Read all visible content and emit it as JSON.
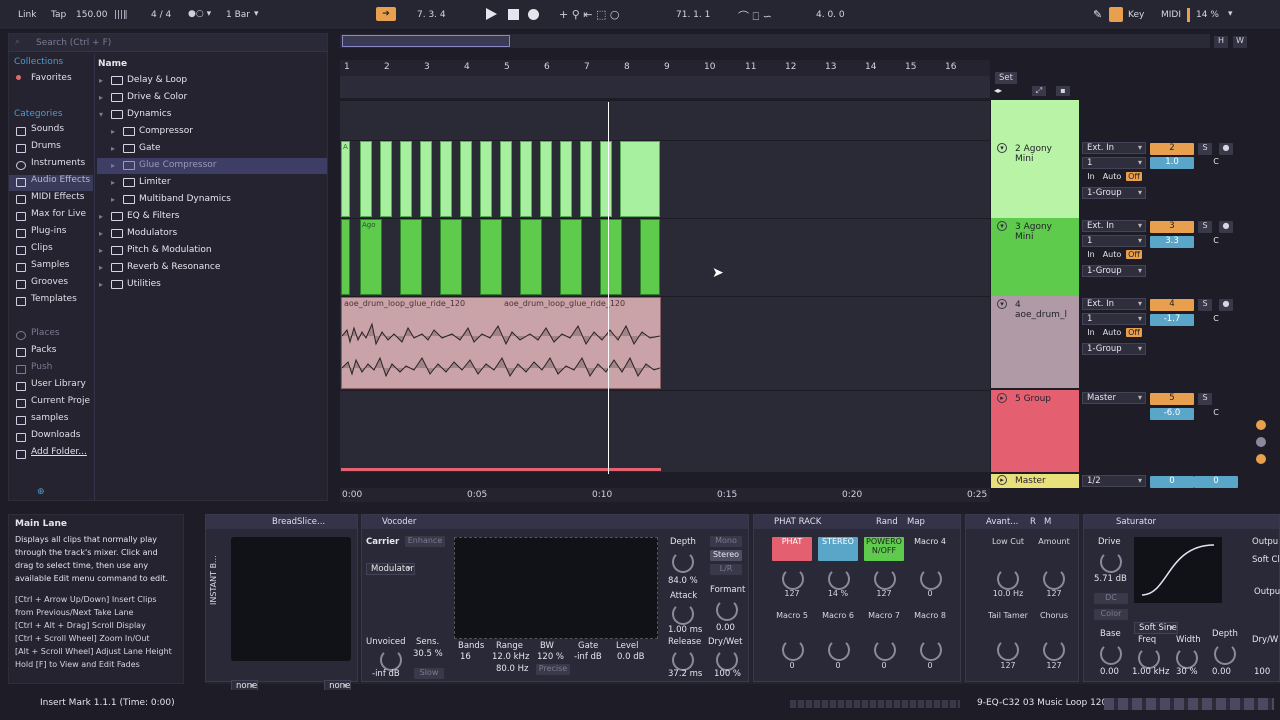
{
  "transport": {
    "link": "Link",
    "tap": "Tap",
    "tempo": "150.00",
    "sig": "4 / 4",
    "quant": "1 Bar",
    "position": "7.  3.  4",
    "loop_start": "71.  1.  1",
    "loop_len": "4.  0.  0",
    "key": "Key",
    "midi": "MIDI",
    "cpu": "14 %"
  },
  "browser": {
    "search_placeholder": "Search (Ctrl + F)",
    "collections_title": "Collections",
    "favorites": "Favorites",
    "categories_title": "Categories",
    "categories": [
      "Sounds",
      "Drums",
      "Instruments",
      "Audio Effects",
      "MIDI Effects",
      "Max for Live",
      "Plug-ins",
      "Clips",
      "Samples",
      "Grooves",
      "Templates"
    ],
    "places_title": "Places",
    "places": [
      "Packs",
      "Push",
      "User Library",
      "Current Proje",
      "samples",
      "Downloads",
      "Add Folder..."
    ],
    "name_header": "Name",
    "items": [
      "Delay & Loop",
      "Drive & Color",
      "Dynamics",
      "Compressor",
      "Gate",
      "Glue Compressor",
      "Limiter",
      "Multiband Dynamics",
      "EQ & Filters",
      "Modulators",
      "Pitch & Modulation",
      "Reverb & Resonance",
      "Utilities"
    ]
  },
  "ruler": {
    "bars": [
      "1",
      "2",
      "3",
      "4",
      "5",
      "6",
      "7",
      "8",
      "9",
      "10",
      "11",
      "12",
      "13",
      "14",
      "15",
      "16"
    ],
    "times": [
      "0:00",
      "0:05",
      "0:10",
      "0:15",
      "0:20",
      "0:25"
    ]
  },
  "tracks": [
    {
      "name": "2 Agony Mini",
      "input": "Ext. In",
      "channel": "1",
      "monitor_in": "In",
      "monitor_auto": "Auto",
      "monitor_off": "Off",
      "output": "1-Group",
      "number": "2",
      "solo": "S",
      "vol": "1.0",
      "pan": "C"
    },
    {
      "name": "3 Agony Mini",
      "input": "Ext. In",
      "channel": "1",
      "monitor_in": "In",
      "monitor_auto": "Auto",
      "monitor_off": "Off",
      "output": "1-Group",
      "number": "3",
      "solo": "S",
      "vol": "3.3",
      "pan": "C"
    },
    {
      "name": "4 aoe_drum_l",
      "input": "Ext. In",
      "channel": "1",
      "monitor_in": "In",
      "monitor_auto": "Auto",
      "monitor_off": "Off",
      "output": "1-Group",
      "number": "4",
      "solo": "S",
      "vol": "-1.7",
      "pan": "C"
    },
    {
      "name": "5 Group",
      "output": "Master",
      "number": "5",
      "solo": "S",
      "vol": "-6.0",
      "pan": "C"
    }
  ],
  "master": {
    "name": "Master",
    "output": "1/2",
    "vol": "0",
    "pan": "0"
  },
  "set_label": "Set",
  "clips": {
    "drum_clip_label": "aoe_drum_loop_glue_ride_120",
    "drum_clip_label2": "aoe_drum_loop_glue_ride_120",
    "green_a": "A",
    "green_ago": "Ago"
  },
  "info": {
    "title": "Main Lane",
    "body": "Displays all clips that normally play through the track's mixer. Click and drag to select time, then use any available Edit menu command to edit.",
    "hints": [
      "[Ctrl + Arrow Up/Down] Insert Clips from Previous/Next Take Lane",
      "[Ctrl + Alt + Drag] Scroll Display",
      "[Ctrl + Scroll Wheel] Zoom In/Out",
      "[Alt + Scroll Wheel] Adjust Lane Height",
      "Hold [F] to View and Edit Fades"
    ]
  },
  "devices": {
    "breadslice": {
      "title": "BreadSlice...",
      "side": "INSTANT B...",
      "sel1": "none",
      "sel2": "none"
    },
    "vocoder": {
      "title": "Vocoder",
      "carrier": "Carrier",
      "enhance": "Enhance",
      "modulator": "Modulator",
      "depth": "Depth",
      "depth_val": "84.0 %",
      "attack": "Attack",
      "attack_val": "1.00 ms",
      "release": "Release",
      "release_val": "37.2 ms",
      "mono": "Mono",
      "stereo": "Stereo",
      "lr": "L/R",
      "formant": "Formant",
      "formant_val": "0.00",
      "drywet": "Dry/Wet",
      "drywet_val": "100 %",
      "unvoiced": "Unvoiced",
      "unvoiced_val": "-inf dB",
      "sens": "Sens.",
      "sens_val": "30.5 %",
      "slow": "Slow",
      "bands": "Bands",
      "bands_val": "16",
      "range": "Range",
      "range_val": "12.0 kHz",
      "range_val2": "80.0 Hz",
      "bw": "BW",
      "bw_val": "120 %",
      "precise": "Precise",
      "gate": "Gate",
      "gate_val": "-inf dB",
      "level": "Level",
      "level_val": "0.0 dB"
    },
    "phat": {
      "title": "PHAT RACK",
      "rand": "Rand",
      "map": "Map",
      "m1": "PHAT",
      "m2": "STEREO",
      "m3": "POWERO N/OFF",
      "m4": "Macro 4",
      "v1": "127",
      "v2": "14 %",
      "v3": "127",
      "v4": "0",
      "m5": "Macro 5",
      "m6": "Macro 6",
      "m7": "Macro 7",
      "m8": "Macro 8",
      "v5": "0",
      "v6": "0",
      "v7": "0",
      "v8": "0"
    },
    "avant": {
      "title": "Avant...",
      "r": "R",
      "m": "M",
      "lowcut": "Low Cut",
      "lowcut_val": "10.0 Hz",
      "amount": "Amount",
      "amount_val": "127",
      "tail": "Tail Tamer",
      "tail_val": "127",
      "chorus": "Chorus",
      "chorus_val": "127"
    },
    "saturator": {
      "title": "Saturator",
      "drive": "Drive",
      "drive_val": "5.71 dB",
      "dc": "DC",
      "color": "Color",
      "mode": "Soft Sine",
      "output": "Outpu",
      "softclip": "Soft Cl",
      "base": "Base",
      "base_val": "0.00",
      "freq": "Freq",
      "freq_val": "1.00 kHz",
      "width": "Width",
      "width_val": "30 %",
      "depth": "Depth",
      "depth_val": "0.00",
      "drywet": "Dry/W",
      "drywet_val": "100"
    }
  },
  "status": {
    "left": "Insert Mark 1.1.1 (Time: 0:00)",
    "right": "9-EQ-C32 03 Music Loop 120"
  }
}
